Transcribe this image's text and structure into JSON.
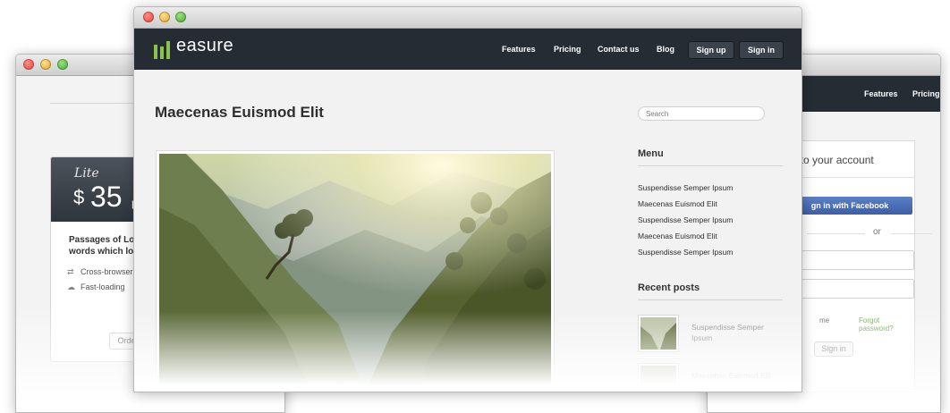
{
  "left_window": {
    "plan": {
      "name": "Lite",
      "currency": "$",
      "price": "35",
      "period": "p",
      "description_line1": "Passages of Lorem",
      "description_line2": "words which look",
      "features": [
        "Cross-browser",
        "Fast-loading"
      ],
      "order_label": "Order"
    }
  },
  "main_window": {
    "logo_text": "easure",
    "nav": {
      "features": "Features",
      "pricing": "Pricing",
      "contact": "Contact us",
      "blog": "Blog",
      "signup": "Sign up",
      "signin": "Sign in"
    },
    "page_title": "Maecenas Euismod Elit",
    "search": {
      "placeholder": "Search"
    },
    "menu": {
      "heading": "Menu",
      "items": [
        "Suspendisse Semper Ipsum",
        "Maecenas Euismod Elit",
        "Suspendisse Semper Ipsum",
        "Maecenas Euismod Elit",
        "Suspendisse Semper Ipsum"
      ]
    },
    "recent_posts": {
      "heading": "Recent posts",
      "posts": [
        {
          "title_line1": "Suspendisse Semper",
          "title_line2": "Ipsum"
        },
        {
          "title_line1": "Maecenas Euismod Elit",
          "title_line2": ""
        }
      ]
    }
  },
  "right_window": {
    "nav": {
      "features": "Features",
      "pricing": "Pricing"
    },
    "login": {
      "title": "in to your account",
      "facebook_button": "gn in with Facebook",
      "or": "or",
      "remember": "me",
      "forgot": "Forgot password?",
      "signin_button": "Sign in"
    }
  },
  "colors": {
    "navbar": "#262c34",
    "logo_accent": "#8bc34a",
    "facebook": "#3b5fa8",
    "link_green": "#6aa84f"
  }
}
